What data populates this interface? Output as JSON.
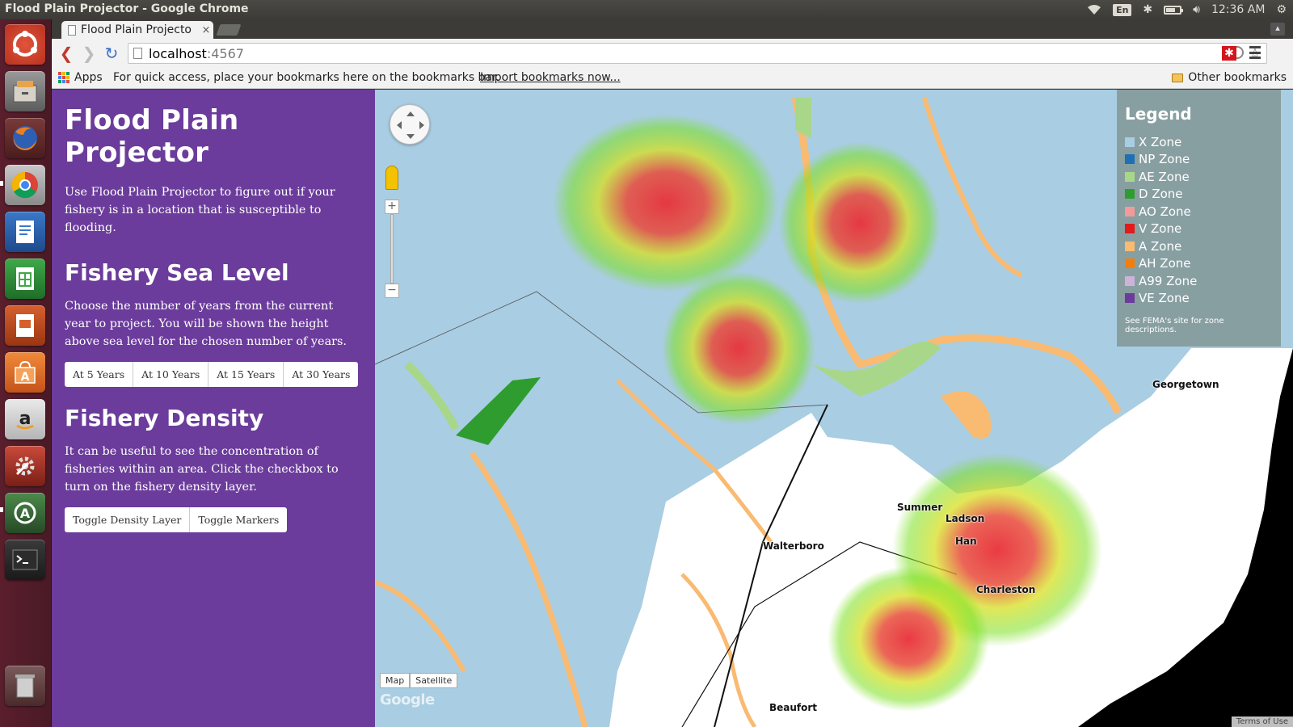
{
  "window": {
    "title": "Flood Plain Projector - Google Chrome"
  },
  "panel": {
    "lang": "En",
    "clock": "12:36 AM",
    "battery_level_pct": 60
  },
  "tab": {
    "title": "Flood Plain Projecto",
    "close": "×"
  },
  "omnibox": {
    "host": "localhost",
    "port": ":4567"
  },
  "bookmarks": {
    "apps": "Apps",
    "hint": "For quick access, place your bookmarks here on the bookmarks bar.",
    "import": "Import bookmarks now...",
    "other": "Other bookmarks"
  },
  "sidebar": {
    "title": "Flood Plain Projector",
    "intro": "Use Flood Plain Projector to figure out if your fishery is in a location that is susceptible to flooding.",
    "sea_level": {
      "heading": "Fishery Sea Level",
      "text": "Choose the number of years from the current year to project. You will be shown the height above sea level for the chosen number of years.",
      "buttons": [
        "At 5 Years",
        "At 10 Years",
        "At 15 Years",
        "At 30 Years"
      ]
    },
    "density": {
      "heading": "Fishery Density",
      "text": "It can be useful to see the concentration of fisheries within an area. Click the checkbox to turn on the fishery density layer.",
      "buttons": [
        "Toggle Density Layer",
        "Toggle Markers"
      ]
    }
  },
  "legend": {
    "title": "Legend",
    "items": [
      {
        "label": "X Zone",
        "color": "#a9cde2"
      },
      {
        "label": "NP Zone",
        "color": "#1f6fb5"
      },
      {
        "label": "AE Zone",
        "color": "#a9d78a"
      },
      {
        "label": "D Zone",
        "color": "#2f9c2f"
      },
      {
        "label": "AO Zone",
        "color": "#f29a9a"
      },
      {
        "label": "V Zone",
        "color": "#e31b1b"
      },
      {
        "label": "A Zone",
        "color": "#f9ba72"
      },
      {
        "label": "AH Zone",
        "color": "#f57d0a"
      },
      {
        "label": "A99 Zone",
        "color": "#cdb3dc"
      },
      {
        "label": "VE Zone",
        "color": "#6b3c9b"
      }
    ],
    "note": "See FEMA's site for zone descriptions."
  },
  "map": {
    "cities": [
      "Georgetown",
      "Summer",
      "Ladson",
      "Han",
      "Walterboro",
      "Charleston",
      "Beaufort"
    ],
    "map_type": [
      "Map",
      "Satellite"
    ],
    "google": "Google",
    "terms": "Terms of Use",
    "zoom_in": "+",
    "zoom_out": "−"
  }
}
